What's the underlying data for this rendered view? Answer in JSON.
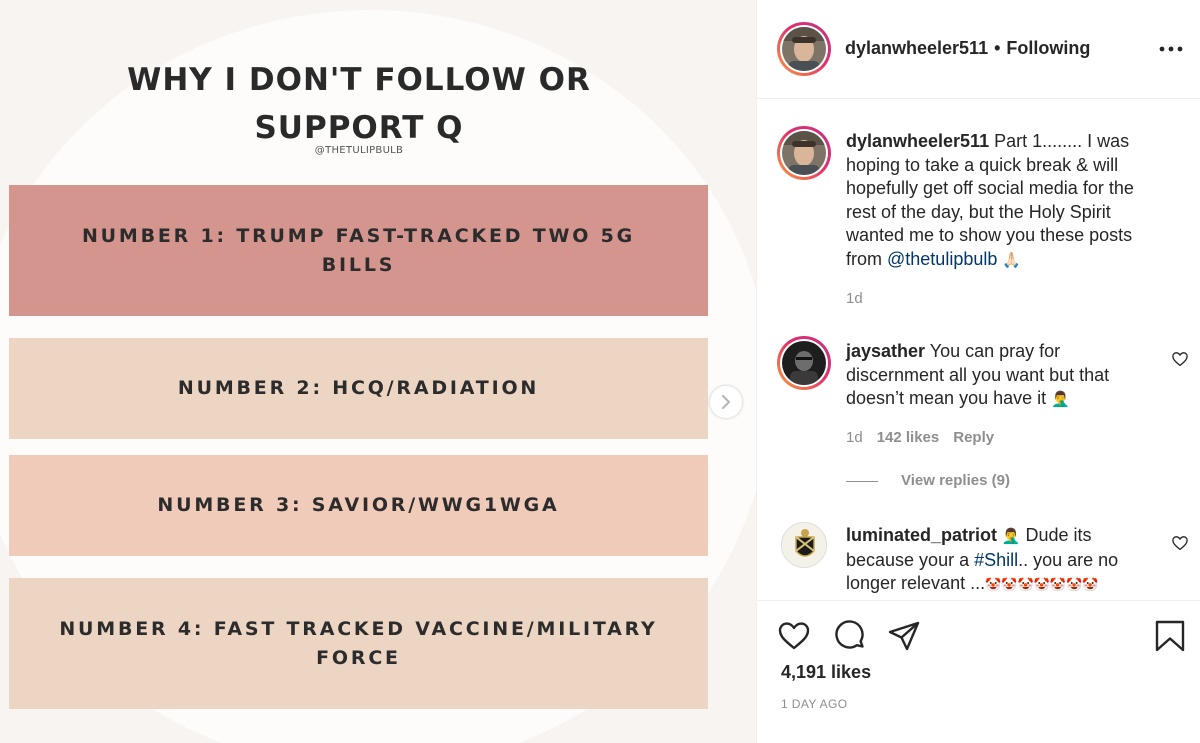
{
  "post_image": {
    "title": "WHY I DON'T FOLLOW OR SUPPORT Q",
    "handle": "@THETULIPBULB",
    "reasons": [
      {
        "text": "NUMBER 1: TRUMP FAST-TRACKED TWO 5G BILLS",
        "color": "#d4958f"
      },
      {
        "text": "NUMBER 2: HCQ/RADIATION",
        "color": "#ecd5c3"
      },
      {
        "text": "NUMBER 3: SAVIOR/WWG1WGA",
        "color": "#f1cbb9"
      },
      {
        "text": "NUMBER 4: FAST TRACKED VACCINE/MILITARY FORCE",
        "color": "#ecd5c3"
      }
    ],
    "next_icon": "chevron-right-icon"
  },
  "header": {
    "username": "dylanwheeler511",
    "separator": "•",
    "follow_status": "Following",
    "more_icon": "more-horizontal-icon"
  },
  "caption": {
    "username": "dylanwheeler511",
    "text_before": " Part 1........ I was hoping to take a quick break & will hopefully get off social media for the rest of the day, but the Holy Spirit wanted me to show you these posts from ",
    "mention": "@thetulipbulb",
    "emoji": "🙏🏻",
    "age": "1d"
  },
  "comments": [
    {
      "username": "jaysather",
      "text": " You can pray for discernment all you want but that doesn’t mean you have it ",
      "emoji": "🤦‍♂️",
      "age": "1d",
      "likes": "142 likes",
      "reply": "Reply",
      "view_replies": "View replies (9)"
    },
    {
      "username": "luminated_patriot",
      "emoji_lead": " 🤦‍♂️",
      "text_before": " Dude its because your a ",
      "hashtag": "#Shill",
      "text_after": ".. you are no longer relevant ...",
      "emoji_tail": "🤡🤡🤡🤡🤡🤡🤡"
    }
  ],
  "actions": {
    "like_icon": "heart-icon",
    "comment_icon": "comment-icon",
    "share_icon": "send-icon",
    "save_icon": "bookmark-icon",
    "likes": "4,191 likes",
    "timestamp": "1 DAY AGO"
  },
  "colors": {
    "link": "#00376b",
    "muted": "#8e8e8e",
    "text": "#262626"
  }
}
